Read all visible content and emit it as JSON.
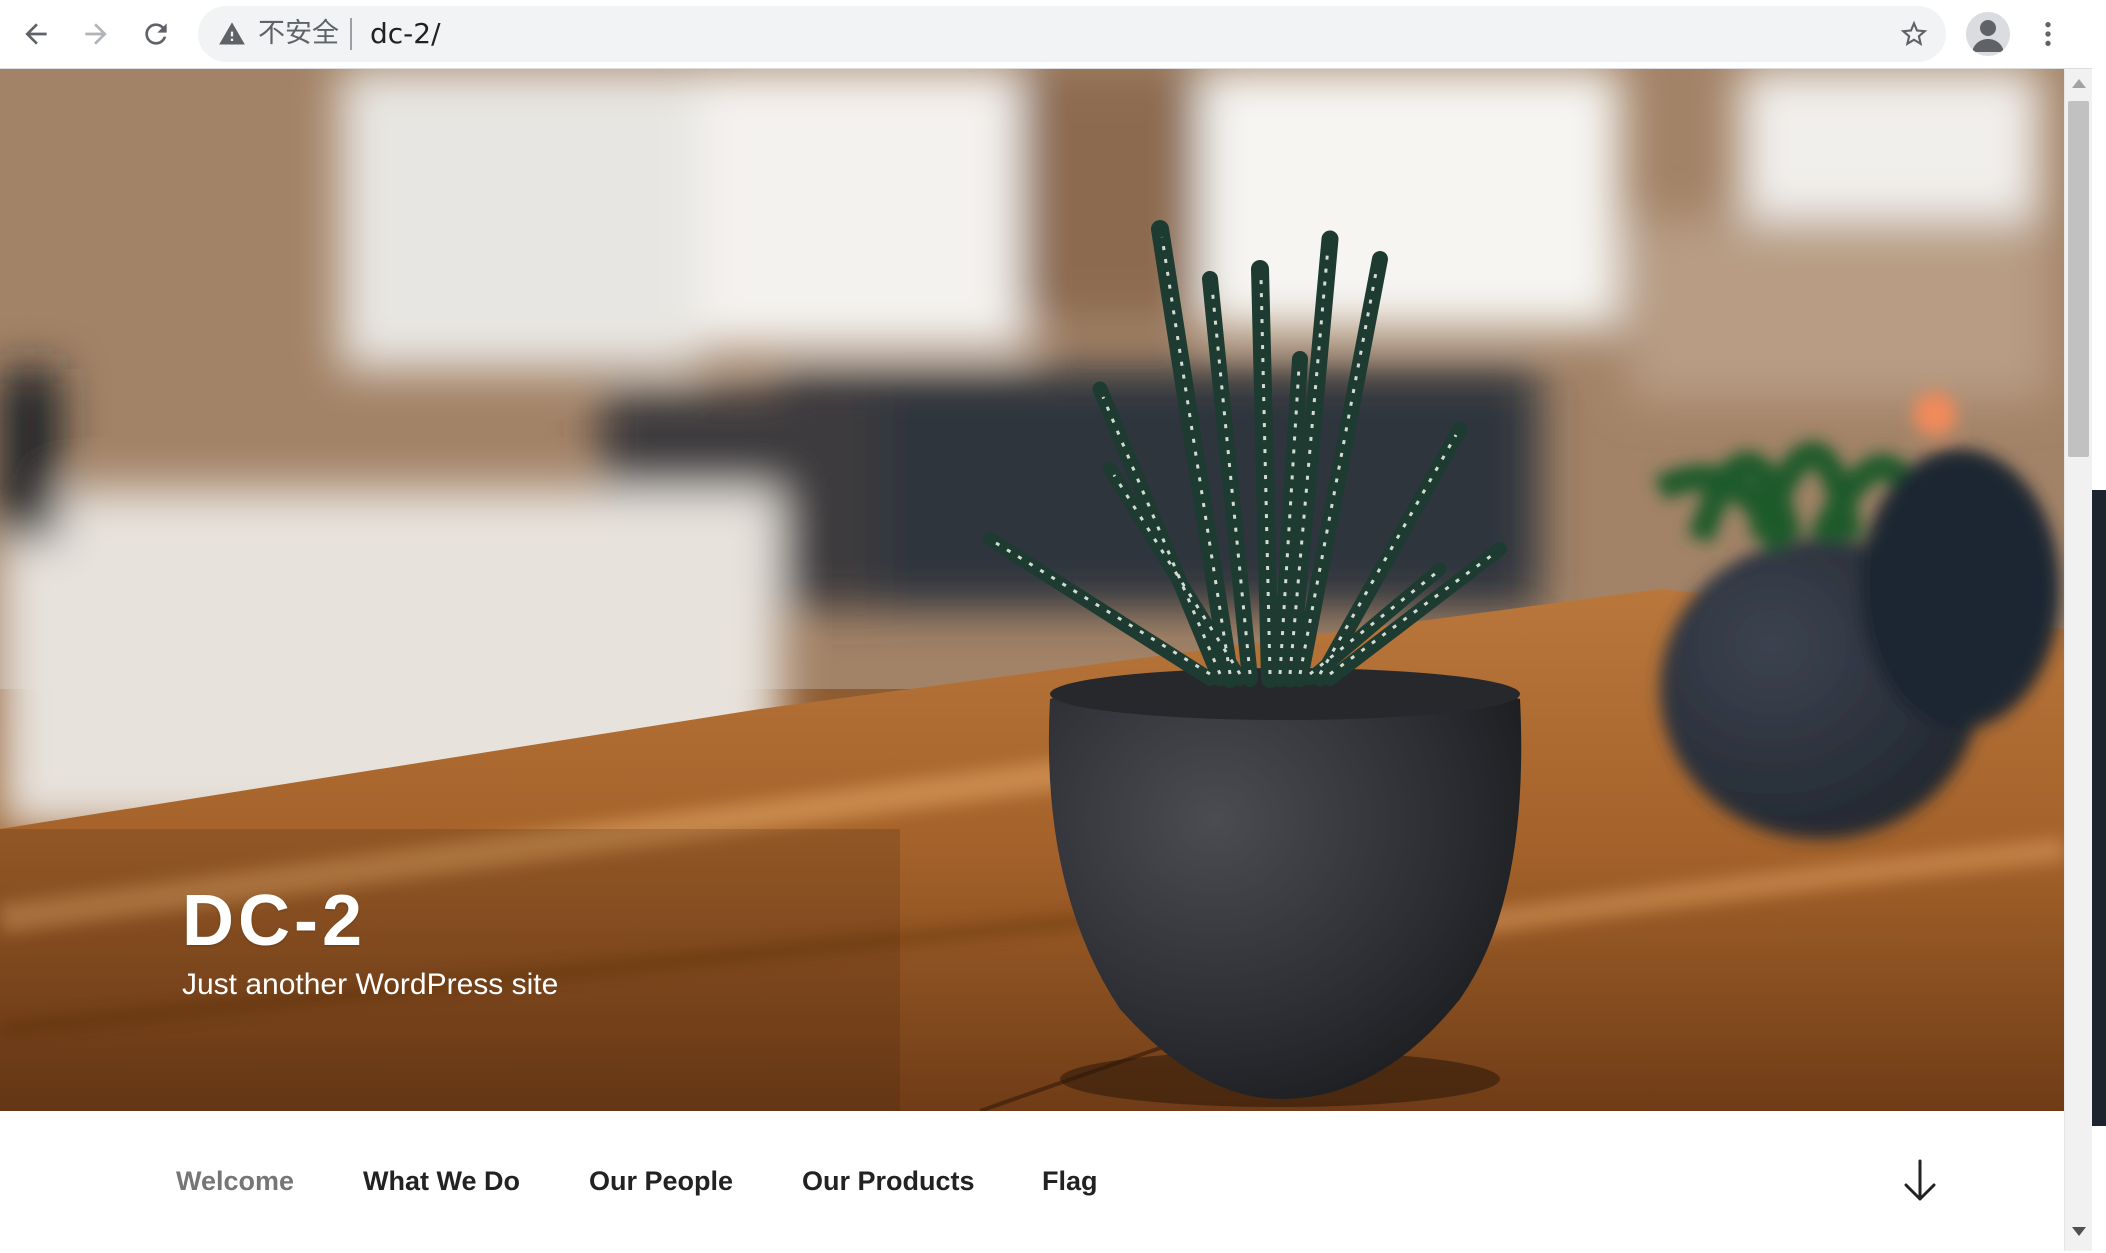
{
  "browser": {
    "security_label": "不安全",
    "url": "dc-2/"
  },
  "site": {
    "title": "DC-2",
    "description": "Just another WordPress site"
  },
  "nav": {
    "items": [
      {
        "label": "Welcome",
        "current": true
      },
      {
        "label": "What We Do",
        "current": false
      },
      {
        "label": "Our People",
        "current": false
      },
      {
        "label": "Our Products",
        "current": false
      },
      {
        "label": "Flag",
        "current": false
      }
    ]
  },
  "icons": {
    "back": "arrow-left-icon",
    "forward": "arrow-right-icon",
    "reload": "reload-icon",
    "warning": "warning-triangle-icon",
    "bookmark": "star-outline-icon",
    "profile": "person-icon",
    "menu": "kebab-menu-icon",
    "scroll_down": "arrow-down-icon"
  },
  "colors": {
    "nav_text": "#222222",
    "nav_current": "#767676",
    "omnibox_bg": "#f1f3f4",
    "hero_title": "#ffffff"
  }
}
